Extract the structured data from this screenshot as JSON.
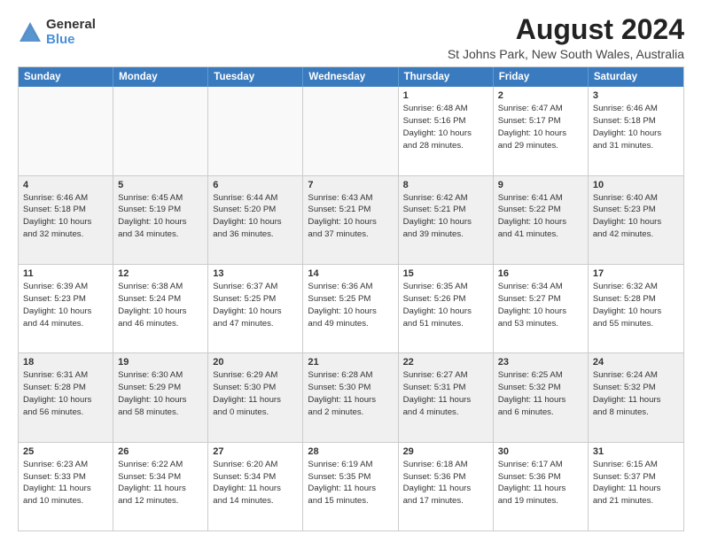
{
  "logo": {
    "general": "General",
    "blue": "Blue"
  },
  "title": "August 2024",
  "subtitle": "St Johns Park, New South Wales, Australia",
  "days": [
    "Sunday",
    "Monday",
    "Tuesday",
    "Wednesday",
    "Thursday",
    "Friday",
    "Saturday"
  ],
  "weeks": [
    [
      {
        "day": "",
        "info": "",
        "empty": true
      },
      {
        "day": "",
        "info": "",
        "empty": true
      },
      {
        "day": "",
        "info": "",
        "empty": true
      },
      {
        "day": "",
        "info": "",
        "empty": true
      },
      {
        "day": "1",
        "info": "Sunrise: 6:48 AM\nSunset: 5:16 PM\nDaylight: 10 hours\nand 28 minutes.",
        "empty": false
      },
      {
        "day": "2",
        "info": "Sunrise: 6:47 AM\nSunset: 5:17 PM\nDaylight: 10 hours\nand 29 minutes.",
        "empty": false
      },
      {
        "day": "3",
        "info": "Sunrise: 6:46 AM\nSunset: 5:18 PM\nDaylight: 10 hours\nand 31 minutes.",
        "empty": false
      }
    ],
    [
      {
        "day": "4",
        "info": "Sunrise: 6:46 AM\nSunset: 5:18 PM\nDaylight: 10 hours\nand 32 minutes.",
        "empty": false
      },
      {
        "day": "5",
        "info": "Sunrise: 6:45 AM\nSunset: 5:19 PM\nDaylight: 10 hours\nand 34 minutes.",
        "empty": false
      },
      {
        "day": "6",
        "info": "Sunrise: 6:44 AM\nSunset: 5:20 PM\nDaylight: 10 hours\nand 36 minutes.",
        "empty": false
      },
      {
        "day": "7",
        "info": "Sunrise: 6:43 AM\nSunset: 5:21 PM\nDaylight: 10 hours\nand 37 minutes.",
        "empty": false
      },
      {
        "day": "8",
        "info": "Sunrise: 6:42 AM\nSunset: 5:21 PM\nDaylight: 10 hours\nand 39 minutes.",
        "empty": false
      },
      {
        "day": "9",
        "info": "Sunrise: 6:41 AM\nSunset: 5:22 PM\nDaylight: 10 hours\nand 41 minutes.",
        "empty": false
      },
      {
        "day": "10",
        "info": "Sunrise: 6:40 AM\nSunset: 5:23 PM\nDaylight: 10 hours\nand 42 minutes.",
        "empty": false
      }
    ],
    [
      {
        "day": "11",
        "info": "Sunrise: 6:39 AM\nSunset: 5:23 PM\nDaylight: 10 hours\nand 44 minutes.",
        "empty": false
      },
      {
        "day": "12",
        "info": "Sunrise: 6:38 AM\nSunset: 5:24 PM\nDaylight: 10 hours\nand 46 minutes.",
        "empty": false
      },
      {
        "day": "13",
        "info": "Sunrise: 6:37 AM\nSunset: 5:25 PM\nDaylight: 10 hours\nand 47 minutes.",
        "empty": false
      },
      {
        "day": "14",
        "info": "Sunrise: 6:36 AM\nSunset: 5:25 PM\nDaylight: 10 hours\nand 49 minutes.",
        "empty": false
      },
      {
        "day": "15",
        "info": "Sunrise: 6:35 AM\nSunset: 5:26 PM\nDaylight: 10 hours\nand 51 minutes.",
        "empty": false
      },
      {
        "day": "16",
        "info": "Sunrise: 6:34 AM\nSunset: 5:27 PM\nDaylight: 10 hours\nand 53 minutes.",
        "empty": false
      },
      {
        "day": "17",
        "info": "Sunrise: 6:32 AM\nSunset: 5:28 PM\nDaylight: 10 hours\nand 55 minutes.",
        "empty": false
      }
    ],
    [
      {
        "day": "18",
        "info": "Sunrise: 6:31 AM\nSunset: 5:28 PM\nDaylight: 10 hours\nand 56 minutes.",
        "empty": false
      },
      {
        "day": "19",
        "info": "Sunrise: 6:30 AM\nSunset: 5:29 PM\nDaylight: 10 hours\nand 58 minutes.",
        "empty": false
      },
      {
        "day": "20",
        "info": "Sunrise: 6:29 AM\nSunset: 5:30 PM\nDaylight: 11 hours\nand 0 minutes.",
        "empty": false
      },
      {
        "day": "21",
        "info": "Sunrise: 6:28 AM\nSunset: 5:30 PM\nDaylight: 11 hours\nand 2 minutes.",
        "empty": false
      },
      {
        "day": "22",
        "info": "Sunrise: 6:27 AM\nSunset: 5:31 PM\nDaylight: 11 hours\nand 4 minutes.",
        "empty": false
      },
      {
        "day": "23",
        "info": "Sunrise: 6:25 AM\nSunset: 5:32 PM\nDaylight: 11 hours\nand 6 minutes.",
        "empty": false
      },
      {
        "day": "24",
        "info": "Sunrise: 6:24 AM\nSunset: 5:32 PM\nDaylight: 11 hours\nand 8 minutes.",
        "empty": false
      }
    ],
    [
      {
        "day": "25",
        "info": "Sunrise: 6:23 AM\nSunset: 5:33 PM\nDaylight: 11 hours\nand 10 minutes.",
        "empty": false
      },
      {
        "day": "26",
        "info": "Sunrise: 6:22 AM\nSunset: 5:34 PM\nDaylight: 11 hours\nand 12 minutes.",
        "empty": false
      },
      {
        "day": "27",
        "info": "Sunrise: 6:20 AM\nSunset: 5:34 PM\nDaylight: 11 hours\nand 14 minutes.",
        "empty": false
      },
      {
        "day": "28",
        "info": "Sunrise: 6:19 AM\nSunset: 5:35 PM\nDaylight: 11 hours\nand 15 minutes.",
        "empty": false
      },
      {
        "day": "29",
        "info": "Sunrise: 6:18 AM\nSunset: 5:36 PM\nDaylight: 11 hours\nand 17 minutes.",
        "empty": false
      },
      {
        "day": "30",
        "info": "Sunrise: 6:17 AM\nSunset: 5:36 PM\nDaylight: 11 hours\nand 19 minutes.",
        "empty": false
      },
      {
        "day": "31",
        "info": "Sunrise: 6:15 AM\nSunset: 5:37 PM\nDaylight: 11 hours\nand 21 minutes.",
        "empty": false
      }
    ]
  ]
}
